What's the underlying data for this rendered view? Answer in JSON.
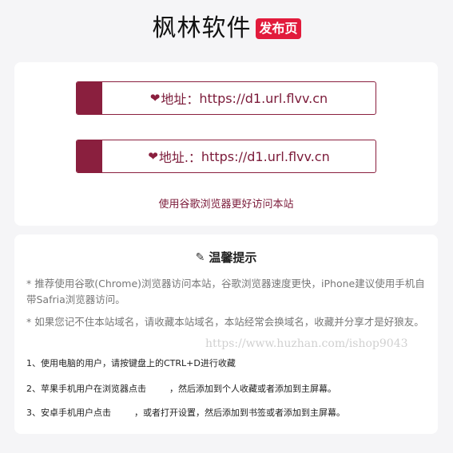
{
  "header": {
    "title": "枫林软件",
    "badge": "发布页"
  },
  "links": [
    {
      "icon": "heart-icon",
      "label": "地址：",
      "url": "https://d1.url.flvv.cn"
    },
    {
      "icon": "heart-icon",
      "label": "地址.：",
      "url": "https://d1.url.flvv.cn"
    }
  ],
  "browser_hint": "使用谷歌浏览器更好访问本站",
  "tips": {
    "heading": "温馨提示",
    "heading_icon": "pencil-icon",
    "paragraphs": [
      "* 推荐使用谷歌(Chrome)浏览器访问本站，谷歌浏览器速度更快，iPhone建议使用手机自带Safria浏览器访问。",
      "* 如果您记不住本站域名，请收藏本站域名，本站经常会换域名，收藏并分享才是好狼友。"
    ],
    "steps": [
      {
        "before": "1、使用电脑的用户，请按键盘上的CTRL+D进行收藏",
        "after": ""
      },
      {
        "before": "2、苹果手机用户在浏览器点击",
        "after": "，然后添加到个人收藏或者添加到主屏幕。"
      },
      {
        "before": "3、安卓手机用户点击",
        "after": "，或者打开设置，然后添加到书签或者添加到主屏幕。"
      }
    ]
  },
  "watermark": "https://www.huzhan.com/ishop9043",
  "colors": {
    "accent": "#8a1f3e",
    "badge": "#e21b3c",
    "background": "#f5f5f7"
  }
}
